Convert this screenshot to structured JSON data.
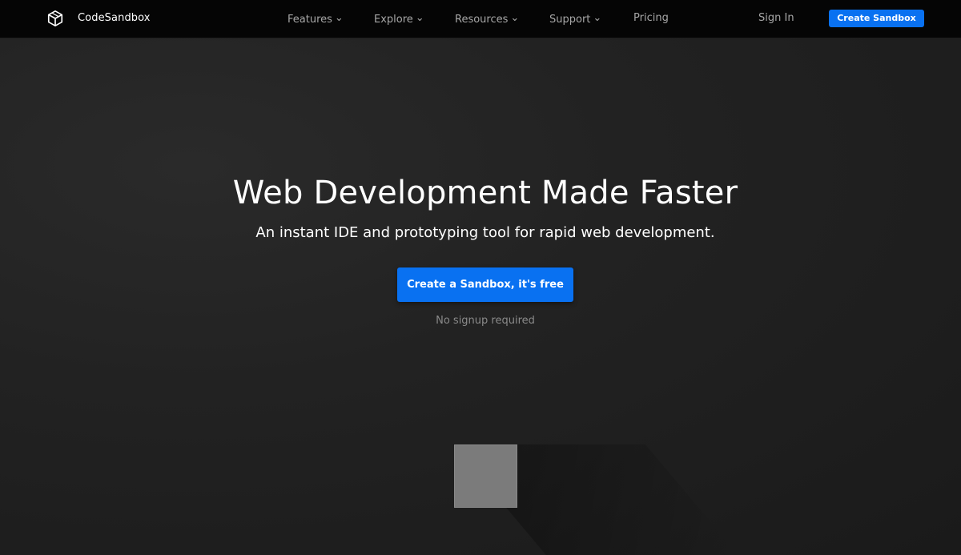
{
  "header": {
    "brand": "CodeSandbox",
    "logo_icon": "codesandbox-cube-icon",
    "nav": [
      {
        "label": "Features",
        "has_dropdown": true
      },
      {
        "label": "Explore",
        "has_dropdown": true
      },
      {
        "label": "Resources",
        "has_dropdown": true
      },
      {
        "label": "Support",
        "has_dropdown": true
      },
      {
        "label": "Pricing",
        "has_dropdown": false
      }
    ],
    "dropdown_glyph": "⌄",
    "signin_label": "Sign In",
    "create_button_label": "Create Sandbox"
  },
  "hero": {
    "title": "Web Development Made Faster",
    "subtitle": "An instant IDE and prototyping tool for rapid web development.",
    "cta_label": "Create a Sandbox, it's free",
    "note": "No signup required"
  },
  "colors": {
    "accent": "#0971f1",
    "header_bg": "#050505",
    "page_bg": "#1c1c1c",
    "nav_text": "#a7a7a7",
    "cube": "#7b7b7b"
  }
}
